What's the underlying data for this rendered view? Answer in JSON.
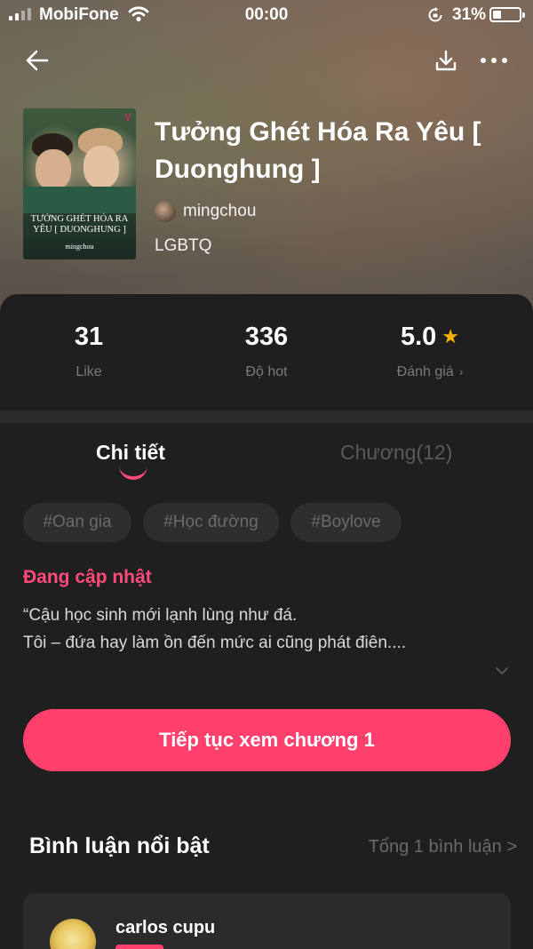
{
  "status_bar": {
    "carrier": "MobiFone",
    "time": "00:00",
    "battery_percent": "31%",
    "battery_level": 0.31
  },
  "nav": {
    "back_icon": "arrow-left-icon",
    "download_icon": "download-icon",
    "more_icon": "more-horizontal-icon"
  },
  "book": {
    "cover_title_line1": "TƯỞNG GHÉT HÓA RA",
    "cover_title_line2": "YÊU [ DUONGHUNG ]",
    "cover_author": "mingchou",
    "title": "Tưởng Ghét Hóa Ra Yêu [ Duonghung ]",
    "author": "mingchou",
    "genre": "LGBTQ"
  },
  "stats": {
    "like_value": "31",
    "like_label": "Like",
    "hot_value": "336",
    "hot_label": "Độ hot",
    "rating_value": "5.0",
    "rating_label": "Đánh giá",
    "star_color": "#f5b400"
  },
  "tabs": {
    "detail": "Chi tiết",
    "chapters": "Chương(12)"
  },
  "tags": [
    "#Oan gia",
    "#Học đường",
    "#Boylove"
  ],
  "detail": {
    "status": "Đang cập nhật",
    "description_line1": "“Cậu học sinh mới lạnh lùng như đá.",
    "description_line2": "Tôi – đứa hay làm ồn đến mức ai cũng phát điên...."
  },
  "continue_button": "Tiếp tục xem chương 1",
  "comments": {
    "title": "Bình luận nổi bật",
    "total": "Tổng 1 bình luận >",
    "items": [
      {
        "user": "carlos cupu"
      }
    ]
  },
  "colors": {
    "accent": "#ff3f6c",
    "background": "#1f1f1f"
  }
}
